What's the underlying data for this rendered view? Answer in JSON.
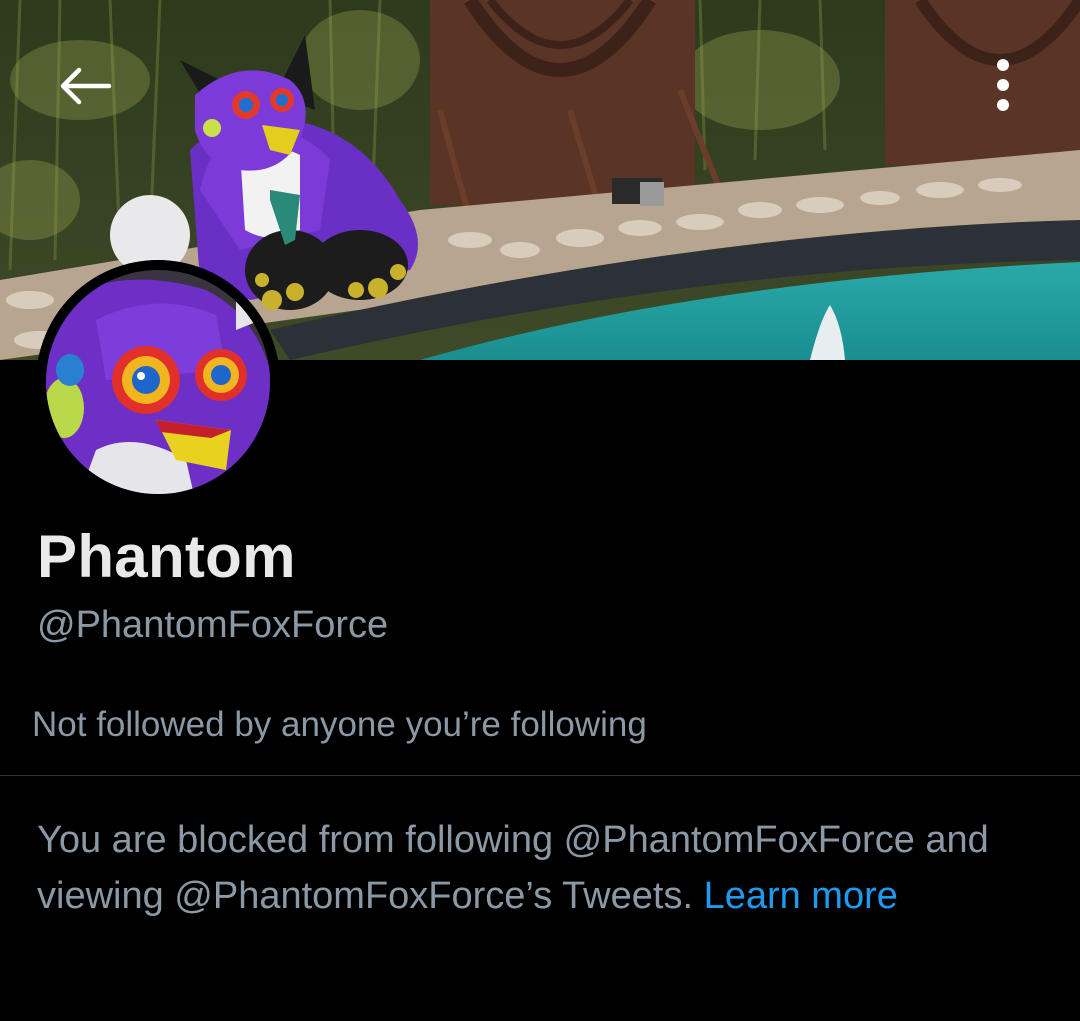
{
  "header": {
    "back_icon": "arrow-left-icon",
    "more_icon": "vertical-ellipsis-icon"
  },
  "banner": {
    "description_icon": "banner-photo"
  },
  "profile": {
    "display_name": "Phantom",
    "handle": "@PhantomFoxForce",
    "followed_by": "Not followed by anyone you’re following"
  },
  "blocked_notice": {
    "text": "You are blocked from following @PhantomFoxForce and viewing @PhantomFoxForce’s Tweets. ",
    "link_text": "Learn more"
  },
  "colors": {
    "background": "#000000",
    "primary_text": "#e7e9ea",
    "secondary_text": "#8b98a5",
    "link": "#1d9bf0",
    "divider": "#2f3336"
  }
}
